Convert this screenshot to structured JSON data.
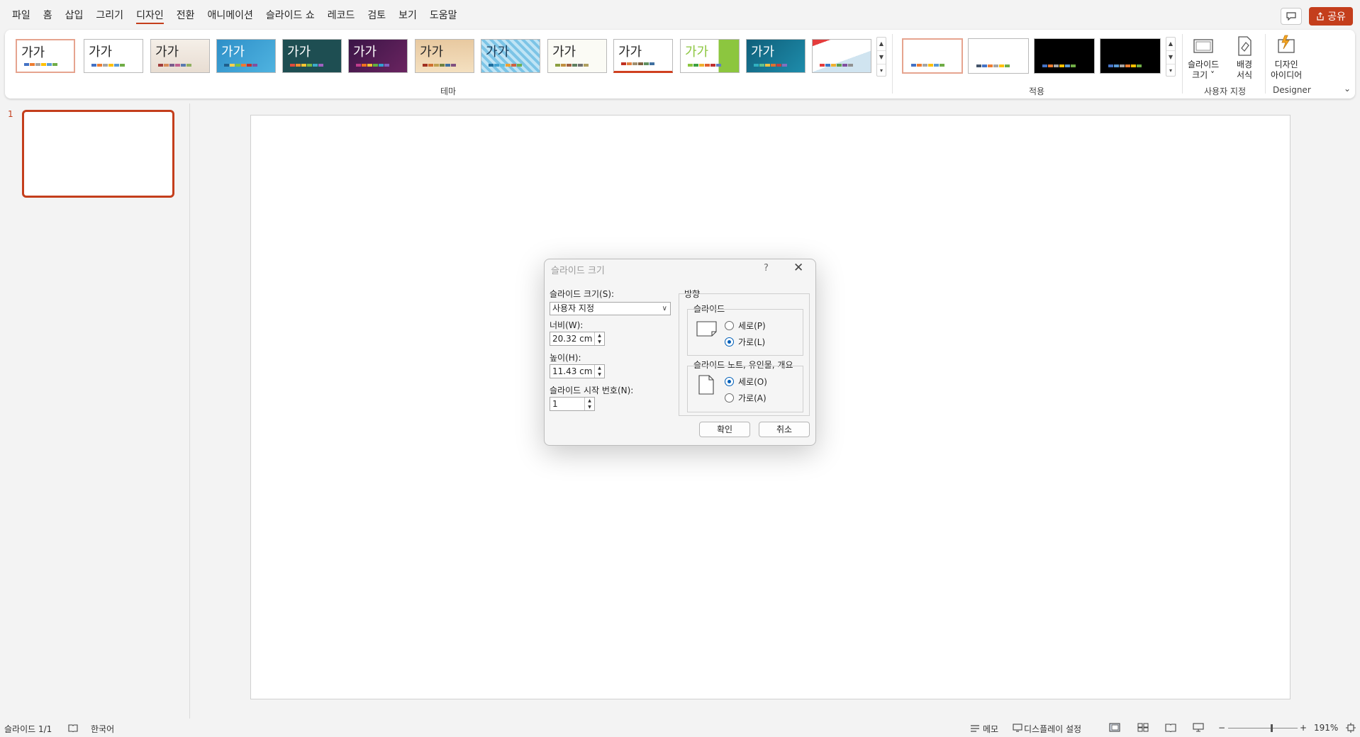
{
  "menu": {
    "tabs": [
      "파일",
      "홈",
      "삽입",
      "그리기",
      "디자인",
      "전환",
      "애니메이션",
      "슬라이드 쇼",
      "레코드",
      "검토",
      "보기",
      "도움말"
    ],
    "active": "디자인",
    "share_label": "공유"
  },
  "ribbon": {
    "theme_thumb_text": "가가",
    "themes_group_label": "테마",
    "variants_group_label": "적용",
    "customize_group_label": "사용자 지정",
    "designer_group_label": "Designer",
    "slide_size_label_1": "슬라이드",
    "slide_size_label_2": "크기 ˅",
    "bg_format_label_1": "배경",
    "bg_format_label_2": "서식",
    "designer_label_1": "디자인",
    "designer_label_2": "아이디어"
  },
  "thumbnails": {
    "slide_number": "1"
  },
  "dialog": {
    "title": "슬라이드 크기",
    "help": "?",
    "slide_size_label": "슬라이드 크기(S):",
    "slide_size_value": "사용자 지정",
    "width_label": "너비(W):",
    "width_value": "20.32 cm",
    "height_label": "높이(H):",
    "height_value": "11.43 cm",
    "start_number_label": "슬라이드 시작 번호(N):",
    "start_number_value": "1",
    "orientation_label": "방향",
    "slide_group_label": "슬라이드",
    "slide_portrait": "세로(P)",
    "slide_landscape": "가로(L)",
    "notes_group_label": "슬라이드 노트, 유인물, 개요",
    "notes_portrait": "세로(O)",
    "notes_landscape": "가로(A)",
    "ok": "확인",
    "cancel": "취소",
    "slide_orientation_selected": "landscape",
    "notes_orientation_selected": "portrait"
  },
  "status": {
    "slide_counter": "슬라이드 1/1",
    "language": "한국어",
    "notes": "메모",
    "display_settings": "디스플레이 설정",
    "zoom": "191%"
  },
  "colors": {
    "accent": "#c43e1c",
    "radio_selected": "#005fb8"
  }
}
